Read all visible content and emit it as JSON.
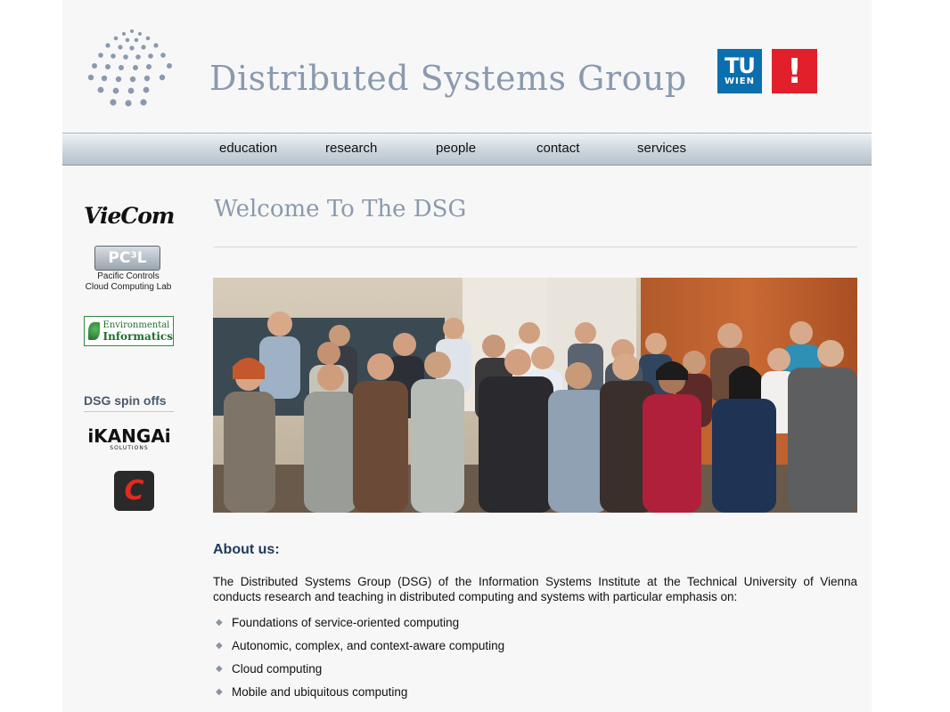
{
  "header": {
    "title": "Distributed Systems Group",
    "tu_logo": {
      "top": "TU",
      "bottom": "WIEN",
      "color": "#0b6fae"
    },
    "excl_logo": {
      "text": "!",
      "color": "#e2202b"
    }
  },
  "nav": {
    "items": [
      "education",
      "research",
      "people",
      "contact",
      "services"
    ]
  },
  "sidebar": {
    "viscom": "VieCom",
    "pc3l": {
      "badge": "PC³L",
      "line1": "Pacific Controls",
      "line2": "Cloud Computing Lab"
    },
    "env_info": {
      "line1": "Environmental",
      "line2": "Informatics"
    },
    "spinoffs_title": "DSG spin offs",
    "ikangai": {
      "name": "iKANGAi",
      "sub": "SOLUTIONS"
    },
    "red_logo": "C"
  },
  "main": {
    "welcome": "Welcome To The DSG",
    "about_title": "About us:",
    "about_text": "The Distributed Systems Group (DSG) of the Information Systems Institute at the Technical University of Vienna conducts research and teaching in distributed computing and systems with particular emphasis on:",
    "topics": [
      "Foundations of service-oriented computing",
      "Autonomic, complex, and context-aware computing",
      "Cloud computing",
      "Mobile and ubiquitous computing"
    ]
  },
  "icons": {
    "bullet": "diamond-bullet-icon"
  },
  "colors": {
    "title": "#8a9aae",
    "about_heading": "#1f3a5c",
    "nav_bg": "#c9d3dc"
  }
}
